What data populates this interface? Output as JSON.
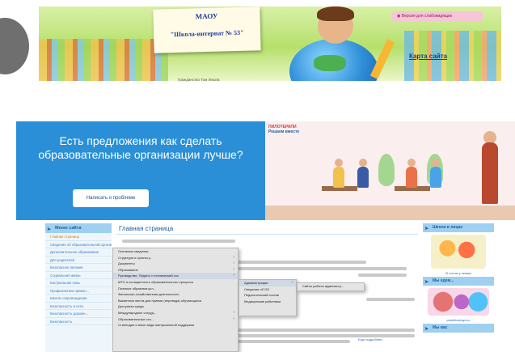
{
  "header": {
    "school_name": "МАОУ",
    "school_full": "\"Школа-интернат № 53\"",
    "login_button": "Версия для слабовидящих",
    "site_map": "Карта сайта",
    "subtitle": "Гражданство Том Лешпа"
  },
  "banner": {
    "text": "Есть предложения как сделать образовательные организации лучше?",
    "button": "Написать о проблеме",
    "room_label_1": "ПИЛОТЕРАПИ",
    "room_label_2": "Решаем вместе"
  },
  "left_menu": {
    "title": "Меню сайта",
    "items": [
      "Главная страница",
      "Сведения об образовательной организации",
      "Дополнительное образование",
      "Для родителей",
      "Безопасное питание",
      "Социальная жизнь",
      "Кастрюльная новь",
      "Профилактика правон...",
      "Школа сопровождения",
      "Безопасность в сети",
      "Безопасность дорожн...",
      "Безопасность"
    ]
  },
  "main": {
    "title": "Главная страница",
    "more_link": "Еще подробнее..."
  },
  "dropdown": {
    "items": [
      "Основные сведения",
      "Структура и органы у...",
      "Документы",
      "Образование",
      "Руководство. Педагог и технический сос",
      "МТО и оснащенность образовательного процесса",
      "Платные образоват.усл...",
      "Финансово-хозяйственная деятельность",
      "Вакантные места для приема (перевода) обучающихся",
      "Доступная среда",
      "Международное сотруд...",
      "Образовательные ста...",
      "Стипендии и иные виды материальной поддержки"
    ],
    "submenu": [
      "Администрация",
      "Сведения об ОО",
      "Педагогический состав",
      "Медицинские работники"
    ],
    "submenu2": "Сайты работы администр..."
  },
  "right_menu": {
    "title_1": "Школа в лицах",
    "caption_1": "В гостях у сказки",
    "title_2": "Мы едем...",
    "caption_2": "pushkinskaya.ru",
    "title_3": "Мы вас"
  }
}
